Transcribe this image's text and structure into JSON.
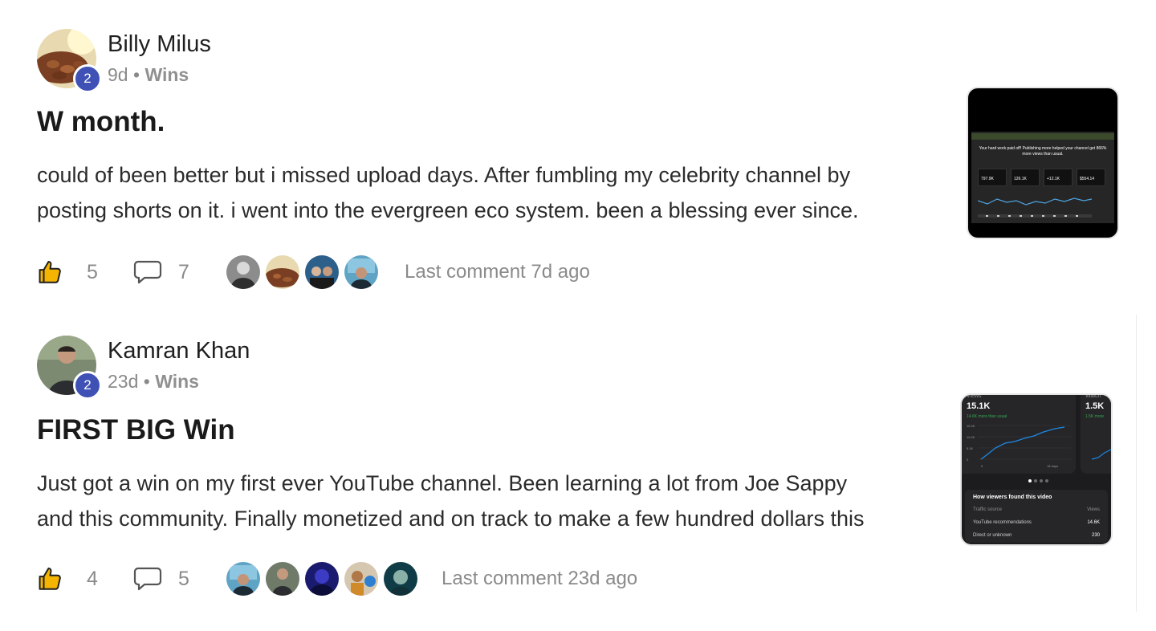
{
  "posts": [
    {
      "author": "Billy Milus",
      "level": "2",
      "age": "9d",
      "separator": "•",
      "category": "Wins",
      "title": "W month.",
      "body_lines": [
        "could of been better but i missed upload days. After fumbling my celebrity channel by",
        "posting shorts on it. i went into the evergreen eco system. been a blessing ever since."
      ],
      "likes": "5",
      "comments": "7",
      "commenter_avatars": [
        "avatar-grey-man",
        "avatar-food",
        "avatar-group",
        "avatar-car-selfie"
      ],
      "last_comment": "Last comment 7d ago",
      "thumbnail": {
        "headline": "Your hard work paid off! Publishing more helped your channel get 866% more views than usual.",
        "card_values": [
          "797.9K",
          "126.1K",
          "+12.1K",
          "$554.14"
        ]
      }
    },
    {
      "author": "Kamran Khan",
      "level": "2",
      "age": "23d",
      "separator": "•",
      "category": "Wins",
      "title": "FIRST BIG Win",
      "body_lines": [
        "Just got a win on my first ever YouTube channel. Been learning a lot from Joe Sappy",
        "and this community. Finally monetized and on track to make a few hundred dollars this"
      ],
      "likes": "4",
      "comments": "5",
      "commenter_avatars": [
        "avatar-car-selfie",
        "avatar-man-jacket",
        "avatar-blue-dark",
        "avatar-chef",
        "avatar-teal-face"
      ],
      "last_comment": "Last comment 23d ago",
      "thumbnail": {
        "views_label": "Views",
        "views_value": "15.1K",
        "views_note": "14.6K more than usual",
        "watch_label": "Watch",
        "watch_value": "1.5K",
        "watch_note": "1.5K more",
        "y_ticks": [
          "15.3K",
          "10.2K",
          "5.1K",
          "0"
        ],
        "x_ticks": [
          "0",
          "18 days"
        ],
        "list_title": "How viewers found this video",
        "list_header_left": "Traffic source",
        "list_header_right": "Views",
        "rows": [
          {
            "label": "YouTube recommendations",
            "value": "14.6K"
          },
          {
            "label": "Direct or unknown",
            "value": "230"
          }
        ]
      }
    }
  ],
  "icons": {
    "like": "thumbs-up-icon",
    "comment": "speech-bubble-icon"
  },
  "colors": {
    "badge": "#3f51b5",
    "like_icon_fill": "#f4b400",
    "muted_text": "#8a8a8a",
    "chart_line": "#1e88e5"
  }
}
